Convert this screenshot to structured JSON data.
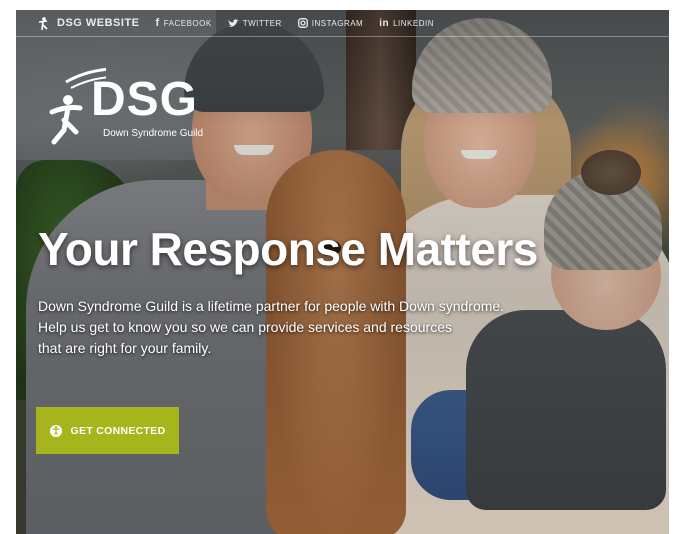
{
  "topbar": {
    "links": [
      {
        "label": "DSG WEBSITE",
        "icon": "person-logo-icon"
      },
      {
        "label": "FACEBOOK",
        "icon": "facebook-icon"
      },
      {
        "label": "TWITTER",
        "icon": "twitter-icon"
      },
      {
        "label": "INSTAGRAM",
        "icon": "instagram-icon"
      },
      {
        "label": "LINKEDIN",
        "icon": "linkedin-icon"
      }
    ]
  },
  "logo": {
    "title": "DSG",
    "subtitle": "Down Syndrome Guild"
  },
  "hero": {
    "headline": "Your Response Matters",
    "body_lines": [
      "Down Syndrome Guild is a lifetime partner for people with Down syndrome.",
      "Help us get to know you so we can provide services and resources",
      "that are right for your family."
    ]
  },
  "cta": {
    "label": "GET CONNECTED",
    "icon": "accessibility-icon",
    "color": "#a7b51c"
  }
}
